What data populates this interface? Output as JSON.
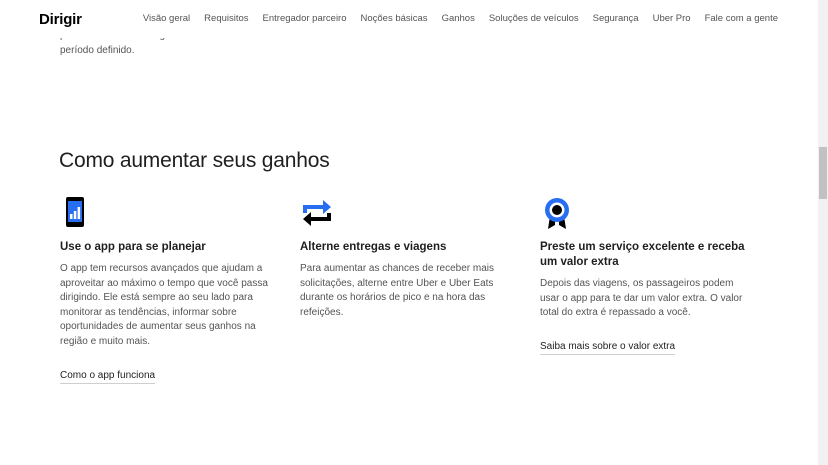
{
  "nav": {
    "brand": "Dirigir",
    "links": [
      "Visão geral",
      "Requisitos",
      "Entregador parceiro",
      "Noções básicas",
      "Ganhos",
      "Soluções de veículos",
      "Segurança",
      "Uber Pro",
      "Fale com a gente"
    ]
  },
  "previous": {
    "lines": [
      "predeterminado de viagens em um",
      "período definido."
    ]
  },
  "section": {
    "title": "Como aumentar seus ganhos",
    "columns": [
      {
        "icon": "phone-chart-icon",
        "title": "Use o app para se planejar",
        "body": "O app tem recursos avançados que ajudam a aproveitar ao máximo o tempo que você passa dirigindo. Ele está sempre ao seu lado para monitorar as tendências, informar sobre oportunidades de aumentar seus ganhos na região e muito mais.",
        "link": "Como o app funciona"
      },
      {
        "icon": "swap-arrows-icon",
        "title": "Alterne entregas e viagens",
        "body": "Para aumentar as chances de receber mais solicitações, alterne entre Uber e Uber Eats durante os horários de pico e na hora das refeições.",
        "link": ""
      },
      {
        "icon": "award-ribbon-icon",
        "title": "Preste um serviço excelente e receba um valor extra",
        "body": "Depois das viagens, os passageiros podem usar o app para te dar um valor extra. O valor total do extra é repassado a você.",
        "link": "Saiba mais sobre o valor extra"
      }
    ]
  },
  "colors": {
    "accent": "#276ef1",
    "dark": "#000000",
    "text": "#545454"
  }
}
